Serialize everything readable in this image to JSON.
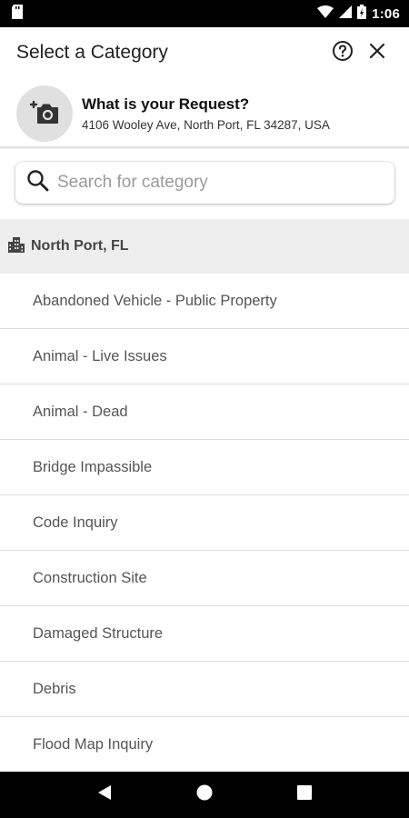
{
  "status_bar": {
    "time": "1:06"
  },
  "header": {
    "title": "Select a Category"
  },
  "request": {
    "title": "What is your Request?",
    "address": "4106 Wooley Ave, North Port, FL 34287, USA"
  },
  "search": {
    "placeholder": "Search for category",
    "value": ""
  },
  "group": {
    "label": "North Port, FL"
  },
  "categories": [
    "Abandoned Vehicle - Public Property",
    "Animal - Live Issues",
    "Animal - Dead",
    "Bridge Impassible",
    "Code Inquiry",
    "Construction Site",
    "Damaged Structure",
    "Debris",
    "Flood Map Inquiry"
  ],
  "icons": {
    "help": "help-circle-icon",
    "close": "close-icon",
    "camera": "add-photo-icon",
    "search": "search-icon",
    "city": "city-icon"
  }
}
